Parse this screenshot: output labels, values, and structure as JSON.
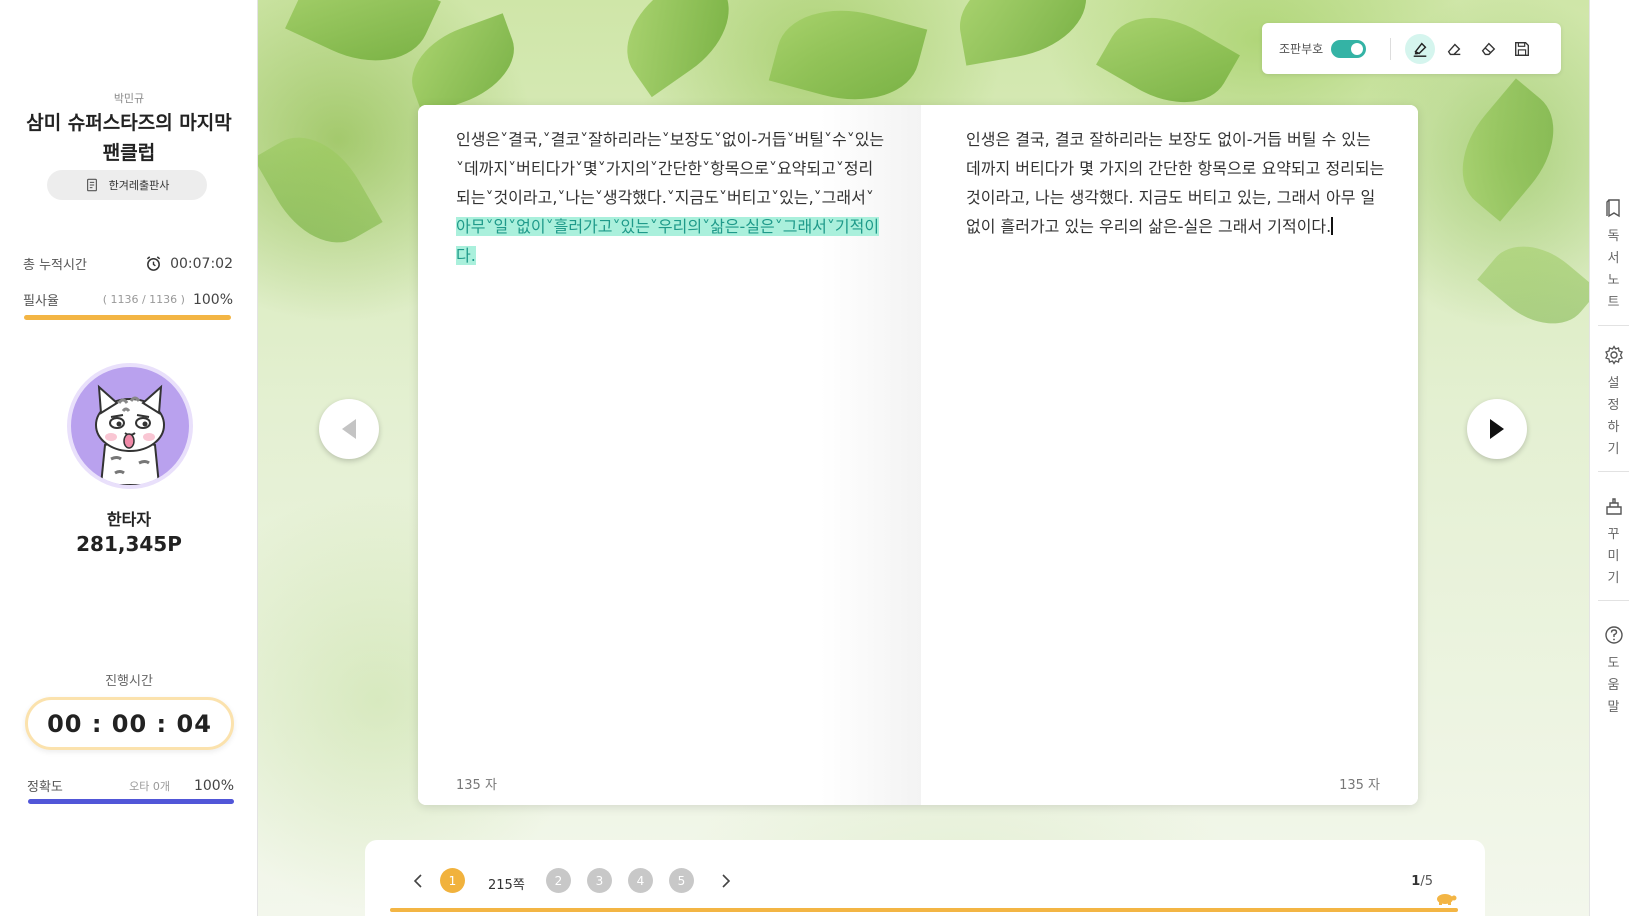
{
  "sidebar": {
    "author": "박민규",
    "book_title": "삼미 슈퍼스타즈의 마지막 팬클럽",
    "publisher": "한겨레출판사",
    "total_time_label": "총 누적시간",
    "total_time_value": "00:07:02",
    "copy_rate_label": "필사율",
    "copy_rate_detail": "( 1136 / 1136 )",
    "copy_rate_value": "100%",
    "user_name": "한타자",
    "user_points": "281,345P",
    "progress_time_label": "진행시간",
    "timer": "00 : 00 : 04",
    "accuracy_label": "정확도",
    "accuracy_detail": "오타 0개",
    "accuracy_value": "100%"
  },
  "toolbar": {
    "toggle_label": "조판부호",
    "toggle_on": true,
    "tools": [
      "highlighter-icon",
      "eraser-icon",
      "eraser-all-icon",
      "save-icon"
    ]
  },
  "book": {
    "left_text_plain": "인생은˅결국,˅결코˅잘하리라는˅보장도˅없이-거듭˅버틸˅수˅있는˅데까지˅버티다가˅몇˅가지의˅간단한˅항목으로˅요약되고˅정리되는˅것이라고,˅나는˅생각했다.˅지금도˅버티고˅있는,˅그래서˅",
    "left_text_highlight": "아무˅일˅없이˅흘러가고˅있는˅우리의˅삶은-실은˅그래서˅기적이다.",
    "left_count": "135 자",
    "right_text": "인생은 결국, 결코 잘하리라는 보장도 없이-거듭 버틸 수 있는 데까지 버티다가 몇 가지의 간단한 항목으로 요약되고 정리되는 것이라고, 나는 생각했다. 지금도 버티고 있는, 그래서 아무 일 없이 흘러가고 있는 우리의 삶은-실은 그래서 기적이다.",
    "right_count": "135 자"
  },
  "pagination": {
    "pages": [
      "1",
      "2",
      "3",
      "4",
      "5"
    ],
    "current_page_label": "215쪽",
    "current": "1",
    "total": "/5",
    "progress": 1.0
  },
  "rightbar": {
    "items": [
      {
        "icon": "book-note-icon",
        "label": [
          "독",
          "서",
          "노",
          "트"
        ]
      },
      {
        "icon": "settings-icon",
        "label": [
          "설",
          "정",
          "하",
          "기"
        ]
      },
      {
        "icon": "decorate-icon",
        "label": [
          "꾸",
          "미",
          "기"
        ]
      },
      {
        "icon": "help-icon",
        "label": [
          "도",
          "움",
          "말"
        ]
      }
    ]
  },
  "colors": {
    "accent_teal": "#34b3a5",
    "highlight": "#aaf0dc",
    "orange": "#f3b544",
    "blue": "#5156d8",
    "avatar_bg": "#b9a1ee"
  }
}
